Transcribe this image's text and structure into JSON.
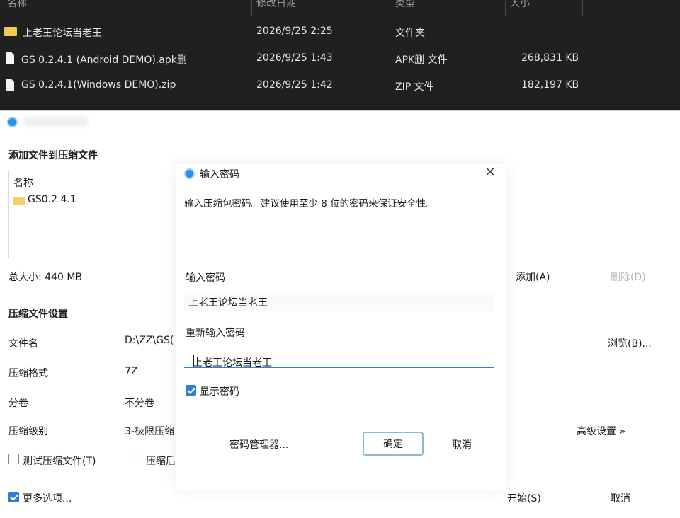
{
  "explorer": {
    "columns": [
      "名称",
      "修改日期",
      "类型",
      "大小"
    ],
    "rows": [
      {
        "icon": "folder-icon",
        "name": "上老王论坛当老王",
        "date": "2026/9/25 2:25",
        "type": "文件夹",
        "size": ""
      },
      {
        "icon": "file-icon",
        "name": "GS 0.2.4.1 (Android DEMO).apk删",
        "date": "2026/9/25 1:43",
        "type": "APK删 文件",
        "size": "268,831 KB"
      },
      {
        "icon": "file-icon",
        "name": "GS 0.2.4.1(Windows DEMO).zip",
        "date": "2026/9/25 1:42",
        "type": "ZIP 文件",
        "size": "182,197 KB"
      }
    ]
  },
  "compress": {
    "heading": "添加文件到压缩文件",
    "list_header": "名称",
    "list_item": "GS0.2.4.1",
    "total_size": "总大小: 440 MB",
    "add_button": "添加(A)",
    "remove_button": "删除(D)",
    "settings_heading": "压缩文件设置",
    "filename_label": "文件名",
    "filename_value": "D:\\ZZ\\GS(",
    "browse_button": "浏览(B)...",
    "format_label": "压缩格式",
    "format_value": "7Z",
    "split_label": "分卷",
    "split_value": "不分卷",
    "level_label": "压缩级别",
    "level_value": "3-极限压缩",
    "advanced_link": "高级设置 »",
    "test_checkbox": "测试压缩文件(T)",
    "after_checkbox": "压缩后",
    "more_options": "更多选项...",
    "start_button": "开始(S)",
    "cancel_button": "取消"
  },
  "password_dialog": {
    "title": "输入密码",
    "description": "输入压缩包密码。建议使用至少 8 位的密码来保证安全性。",
    "password_label": "输入密码",
    "password_value": "上老王论坛当老王",
    "confirm_label": "重新输入密码",
    "confirm_value": "上老王论坛当老王",
    "show_password": "显示密码",
    "manager_button": "密码管理器...",
    "ok_button": "确定",
    "cancel_button": "取消"
  }
}
